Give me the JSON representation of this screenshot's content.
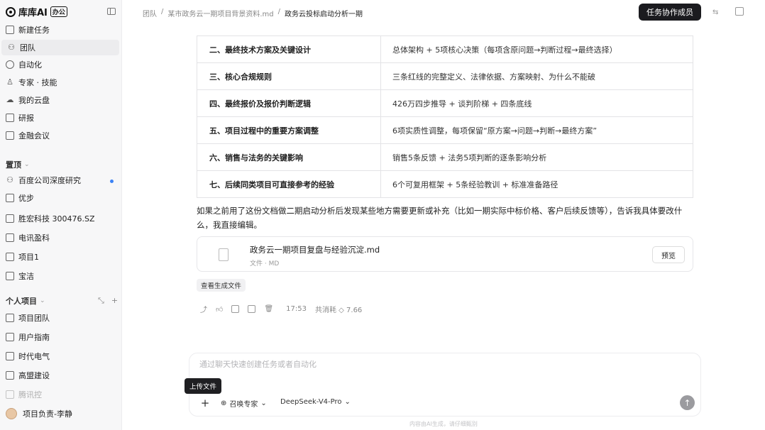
{
  "brand": {
    "name": "库库AI",
    "tag": "办公"
  },
  "sidebar": {
    "nav": [
      {
        "label": "新建任务",
        "icon": "new-task-icon"
      },
      {
        "label": "团队",
        "icon": "team-icon"
      },
      {
        "label": "自动化",
        "icon": "clock-icon"
      },
      {
        "label": "专家 · 技能",
        "icon": "expert-icon"
      },
      {
        "label": "我的云盘",
        "icon": "cloud-icon"
      },
      {
        "label": "研报",
        "icon": "report-icon"
      },
      {
        "label": "金融会议",
        "icon": "meeting-icon"
      }
    ],
    "pinned_title": "置顶",
    "pinned": [
      {
        "label": "百度公司深度研究"
      },
      {
        "label": "优步"
      },
      {
        "label": "胜宏科技 300476.SZ"
      },
      {
        "label": "电讯盈科"
      },
      {
        "label": "项目1"
      },
      {
        "label": "宝洁"
      }
    ],
    "personal_title": "个人项目",
    "personal": [
      {
        "label": "项目团队"
      },
      {
        "label": "用户指南"
      },
      {
        "label": "时代电气"
      },
      {
        "label": "高盟建设"
      },
      {
        "label": "腾讯控"
      }
    ],
    "user": "项目负责-李静"
  },
  "header": {
    "breadcrumb": [
      "团队",
      "某市政务云一期项目背景资料.md",
      "政务云投标启动分析一期"
    ],
    "team_button": "任务协作成员"
  },
  "table": {
    "rows": [
      {
        "a": "二、最终技术方案及关键设计",
        "b": "总体架构 + 5项核心决策（每项含原问题→判断过程→最终选择）"
      },
      {
        "a": "三、核心合规规则",
        "b": "三条红线的完整定义、法律依据、方案映射、为什么不能破"
      },
      {
        "a": "四、最终报价及报价判断逻辑",
        "b": "426万四步推导 + 谈判阶梯 + 四条底线"
      },
      {
        "a": "五、项目过程中的重要方案调整",
        "b": "6项实质性调整，每项保留“原方案→问题→判断→最终方案”"
      },
      {
        "a": "六、销售与法务的关键影响",
        "b": "销售5条反馈 + 法务5项判断的逐条影响分析"
      },
      {
        "a": "七、后续同类项目可直接参考的经验",
        "b": "6个可复用框架 + 5条经验教训 + 标准准备路径"
      }
    ]
  },
  "message": {
    "paragraph": "如果之前用了这份文档做二期启动分析后发现某些地方需要更新或补充（比如一期实际中标价格、客户后续反馈等），告诉我具体要改什么，我直接编辑。",
    "file_name": "政务云一期项目复盘与经验沉淀.md",
    "file_meta": "文件 · MD",
    "preview": "预览",
    "view_generated": "查看生成文件",
    "time": "17:53",
    "credits": "共消耗 ◇ 7.66"
  },
  "composer": {
    "placeholder": "通过聊天快速创建任务或者自动化",
    "tooltip": "上传文件",
    "expert": "召唤专家",
    "model": "DeepSeek-V4-Pro",
    "disclaimer": "内容由AI生成，请仔细甄别"
  }
}
